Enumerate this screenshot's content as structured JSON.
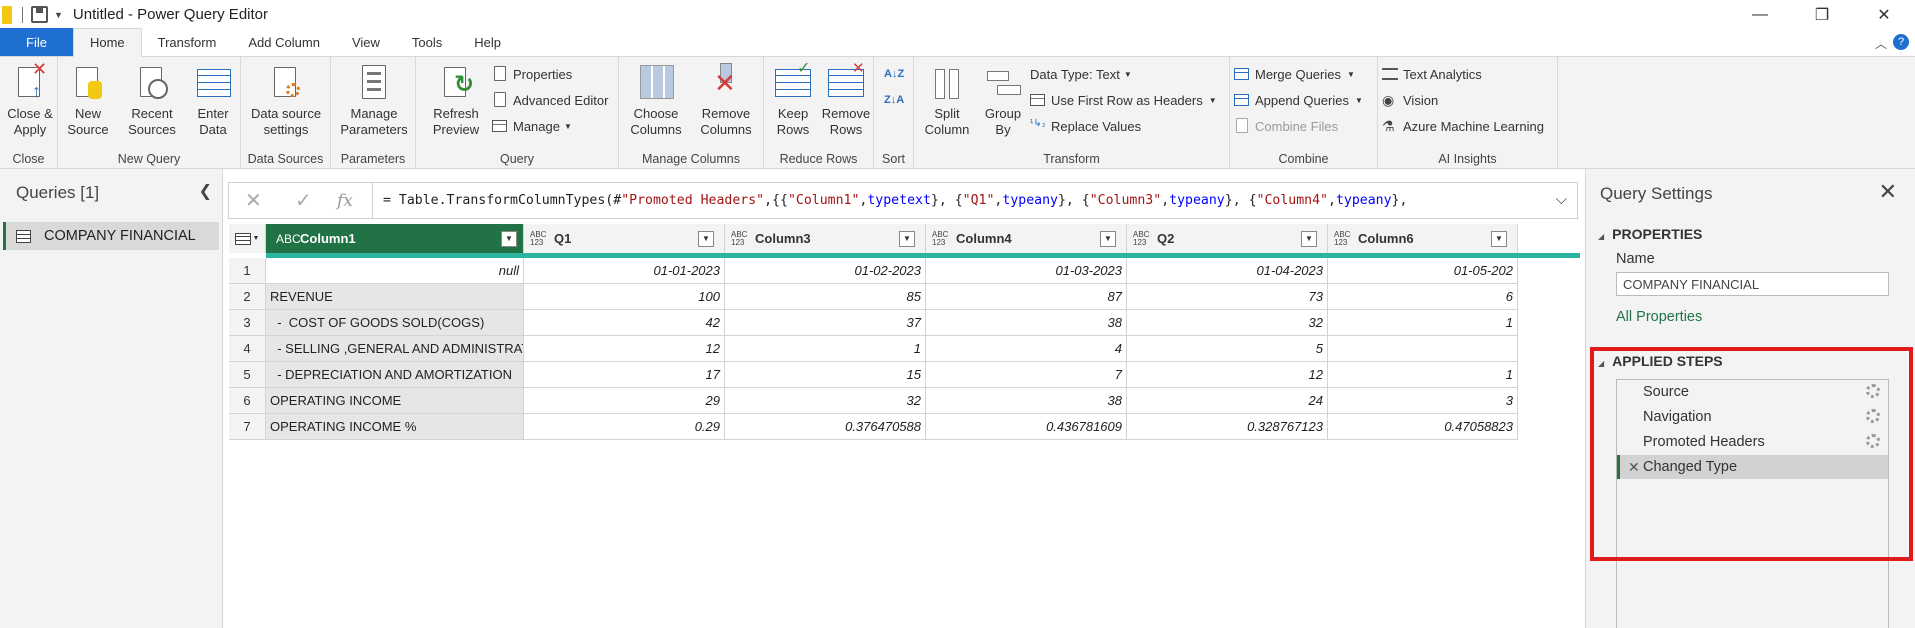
{
  "window": {
    "title": "Untitled - Power Query Editor",
    "minimize": "—",
    "maximize": "❐",
    "close": "✕"
  },
  "menu": {
    "file": "File",
    "tabs": [
      "Home",
      "Transform",
      "Add Column",
      "View",
      "Tools",
      "Help"
    ],
    "active": "Home"
  },
  "ribbon": {
    "close": {
      "label": "Close",
      "close_apply": "Close &\nApply"
    },
    "new_query": {
      "label": "New Query",
      "new_source": "New\nSource",
      "recent_sources": "Recent\nSources",
      "enter_data": "Enter\nData"
    },
    "data_sources": {
      "label": "Data Sources",
      "settings": "Data source\nsettings"
    },
    "parameters": {
      "label": "Parameters",
      "manage": "Manage\nParameters"
    },
    "query": {
      "label": "Query",
      "refresh": "Refresh\nPreview",
      "properties": "Properties",
      "advanced_editor": "Advanced Editor",
      "manage": "Manage"
    },
    "manage_columns": {
      "label": "Manage Columns",
      "choose": "Choose\nColumns",
      "remove": "Remove\nColumns"
    },
    "reduce_rows": {
      "label": "Reduce Rows",
      "keep": "Keep\nRows",
      "remove": "Remove\nRows"
    },
    "sort": {
      "label": "Sort"
    },
    "transform": {
      "label": "Transform",
      "split": "Split\nColumn",
      "group": "Group\nBy",
      "data_type": "Data Type: Text",
      "first_row": "Use First Row as Headers",
      "replace": "Replace Values"
    },
    "combine": {
      "label": "Combine",
      "merge": "Merge Queries",
      "append": "Append Queries",
      "combine_files": "Combine Files"
    },
    "ai": {
      "label": "AI Insights",
      "text_analytics": "Text Analytics",
      "vision": "Vision",
      "azure_ml": "Azure Machine Learning"
    }
  },
  "queries": {
    "title": "Queries [1]",
    "items": [
      "COMPANY FINANCIAL"
    ]
  },
  "formula": "= Table.TransformColumnTypes(#\"Promoted Headers\",{{\"Column1\", type text}, {\"Q1\", type any}, {\"Column3\", type any}, {\"Column4\", type any},",
  "grid": {
    "columns": [
      {
        "name": "Column1",
        "type": "ABC"
      },
      {
        "name": "Q1",
        "type": "ABC\n123"
      },
      {
        "name": "Column3",
        "type": "ABC\n123"
      },
      {
        "name": "Column4",
        "type": "ABC\n123"
      },
      {
        "name": "Q2",
        "type": "ABC\n123"
      },
      {
        "name": "Column6",
        "type": "ABC\n123"
      }
    ],
    "rows": [
      [
        "1",
        "null",
        "01-01-2023",
        "01-02-2023",
        "01-03-2023",
        "01-04-2023",
        "01-05-202"
      ],
      [
        "2",
        "REVENUE",
        "100",
        "85",
        "87",
        "73",
        "6"
      ],
      [
        "3",
        "  -  COST OF GOODS SOLD(COGS)",
        "42",
        "37",
        "38",
        "32",
        "1"
      ],
      [
        "4",
        "  - SELLING ,GENERAL AND ADMINISTRATIVE(SG&A)",
        "12",
        "1",
        "4",
        "5",
        ""
      ],
      [
        "5",
        "  - DEPRECIATION AND AMORTIZATION",
        "17",
        "15",
        "7",
        "12",
        "1"
      ],
      [
        "6",
        "OPERATING INCOME",
        "29",
        "32",
        "38",
        "24",
        "3"
      ],
      [
        "7",
        "OPERATING INCOME %",
        "0.29",
        "0.376470588",
        "0.436781609",
        "0.328767123",
        "0.47058823"
      ]
    ]
  },
  "settings": {
    "title": "Query Settings",
    "properties_heading": "PROPERTIES",
    "name_label": "Name",
    "name_value": "COMPANY FINANCIAL",
    "all_properties": "All Properties",
    "steps_heading": "APPLIED STEPS",
    "steps": [
      "Source",
      "Navigation",
      "Promoted Headers",
      "Changed Type"
    ]
  },
  "colors": {
    "accent_green": "#217346",
    "file_blue": "#1f6fd1",
    "highlight_red": "#e01b1b",
    "quality_bar": "#2bb5a0"
  }
}
